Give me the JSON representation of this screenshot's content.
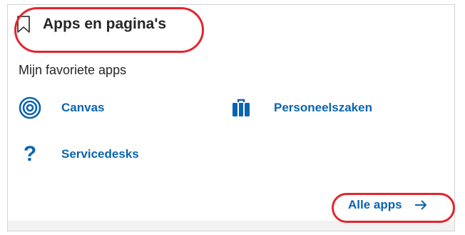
{
  "card": {
    "title": "Apps en pagina's",
    "subtitle": "Mijn favoriete apps",
    "icon": "bookmark-icon"
  },
  "apps": [
    {
      "label": "Canvas",
      "icon": "target-icon"
    },
    {
      "label": "Personeelszaken",
      "icon": "briefcase-icon"
    },
    {
      "label": "Servicedesks",
      "icon": "question-mark-icon"
    }
  ],
  "footer": {
    "all_apps_label": "Alle apps",
    "arrow_icon": "arrow-right-icon"
  },
  "colors": {
    "link": "#0b64b0",
    "text": "#262626",
    "highlight": "#e3262e",
    "border": "#d3d3d3"
  }
}
